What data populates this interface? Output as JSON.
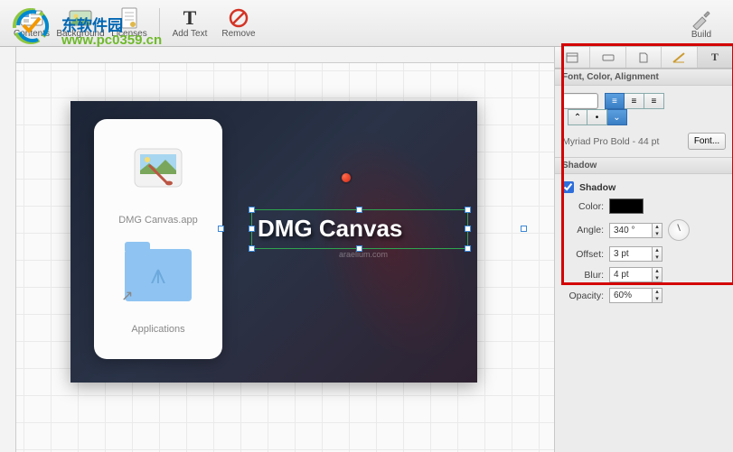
{
  "toolbar": {
    "contents": "Contents",
    "background": "Background",
    "licenses": "Licenses",
    "add_text": "Add Text",
    "remove": "Remove",
    "build": "Build"
  },
  "watermark": {
    "cn": "东软件园",
    "url": "www.pc0359.cn"
  },
  "canvas": {
    "app_label": "DMG Canvas.app",
    "folder_label": "Applications",
    "main_text": "DMG Canvas",
    "sub_text": "araelium.com"
  },
  "inspector": {
    "section_font": "Font, Color, Alignment",
    "font_desc": "Myriad Pro Bold - 44 pt",
    "font_btn": "Font...",
    "section_shadow": "Shadow",
    "shadow_on": "Shadow",
    "rows": {
      "color": "Color:",
      "angle": "Angle:",
      "offset": "Offset:",
      "blur": "Blur:",
      "opacity": "Opacity:"
    },
    "vals": {
      "angle": "340 °",
      "offset": "3 pt",
      "blur": "4 pt",
      "opacity": "60%"
    },
    "swatch_color": "#000000"
  }
}
